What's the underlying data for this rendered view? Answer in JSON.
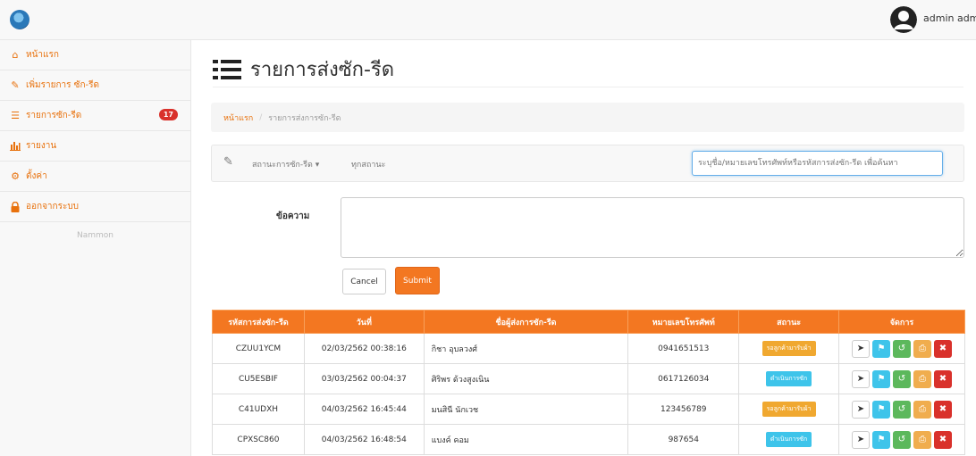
{
  "topbar": {
    "user_label": "admin  adm"
  },
  "sidebar": {
    "items": [
      {
        "label": "หน้าแรก",
        "icon": "home-icon"
      },
      {
        "label": "เพิ่มรายการ ซัก-รีด",
        "icon": "edit-icon"
      },
      {
        "label": "รายการซัก-รีด",
        "icon": "list-icon",
        "badge": "17"
      },
      {
        "label": "รายงาน",
        "icon": "bar-chart-icon"
      },
      {
        "label": "ตั้งค่า",
        "icon": "gear-icon"
      },
      {
        "label": "ออกจากระบบ",
        "icon": "lock-icon"
      }
    ],
    "footer": "Nammon"
  },
  "main": {
    "title": "รายการส่งซัก-รีด",
    "breadcrumb": {
      "home": "หน้าแรก",
      "current": "รายการส่งการซัก-รีด"
    },
    "filter": {
      "dropdown_label": "สถานะการซัก-รีด",
      "status_text": "ทุกสถานะ",
      "search_placeholder": "ระบุชื่อ/หมายเลขโทรศัพท์หรือรหัสการส่งซัก-รีด เพื่อค้นหา"
    },
    "message": {
      "label": "ข้อความ"
    },
    "buttons": {
      "cancel": "Cancel",
      "submit": "Submit"
    }
  },
  "table": {
    "headers": [
      "รหัสการส่งซัก-รีด",
      "วันที่",
      "ชื่อผู้ส่งการซัก-รีด",
      "หมายเลขโทรศัพท์",
      "สถานะ",
      "จัดการ"
    ],
    "rows": [
      {
        "code": "CZUU1YCM",
        "date": "02/03/2562 00:38:16",
        "name": "กิชา  อุบลวงศ์",
        "phone": "0941651513",
        "status": "รอลูกค้ามารับผ้า",
        "status_color": "#f0a830"
      },
      {
        "code": "CU5ESBIF",
        "date": "03/03/2562 00:04:37",
        "name": "ศิริพร  ด้วงสูงเนิน",
        "phone": "0617126034",
        "status": "ดำเนินการซัก",
        "status_color": "#3ec4ea"
      },
      {
        "code": "C41UDXH",
        "date": "04/03/2562 16:45:44",
        "name": "มนสินี  นักเวช",
        "phone": "123456789",
        "status": "รอลูกค้ามารับผ้า",
        "status_color": "#f0a830"
      },
      {
        "code": "CPXSC860",
        "date": "04/03/2562 16:48:54",
        "name": "แบงค์  คอม",
        "phone": "987654",
        "status": "ดำเนินการซัก",
        "status_color": "#3ec4ea"
      }
    ]
  },
  "colors": {
    "accent": "#f37721",
    "danger": "#d9312b",
    "info": "#3ec4ea",
    "success": "#5cb85c",
    "warning": "#f0ad4e"
  }
}
